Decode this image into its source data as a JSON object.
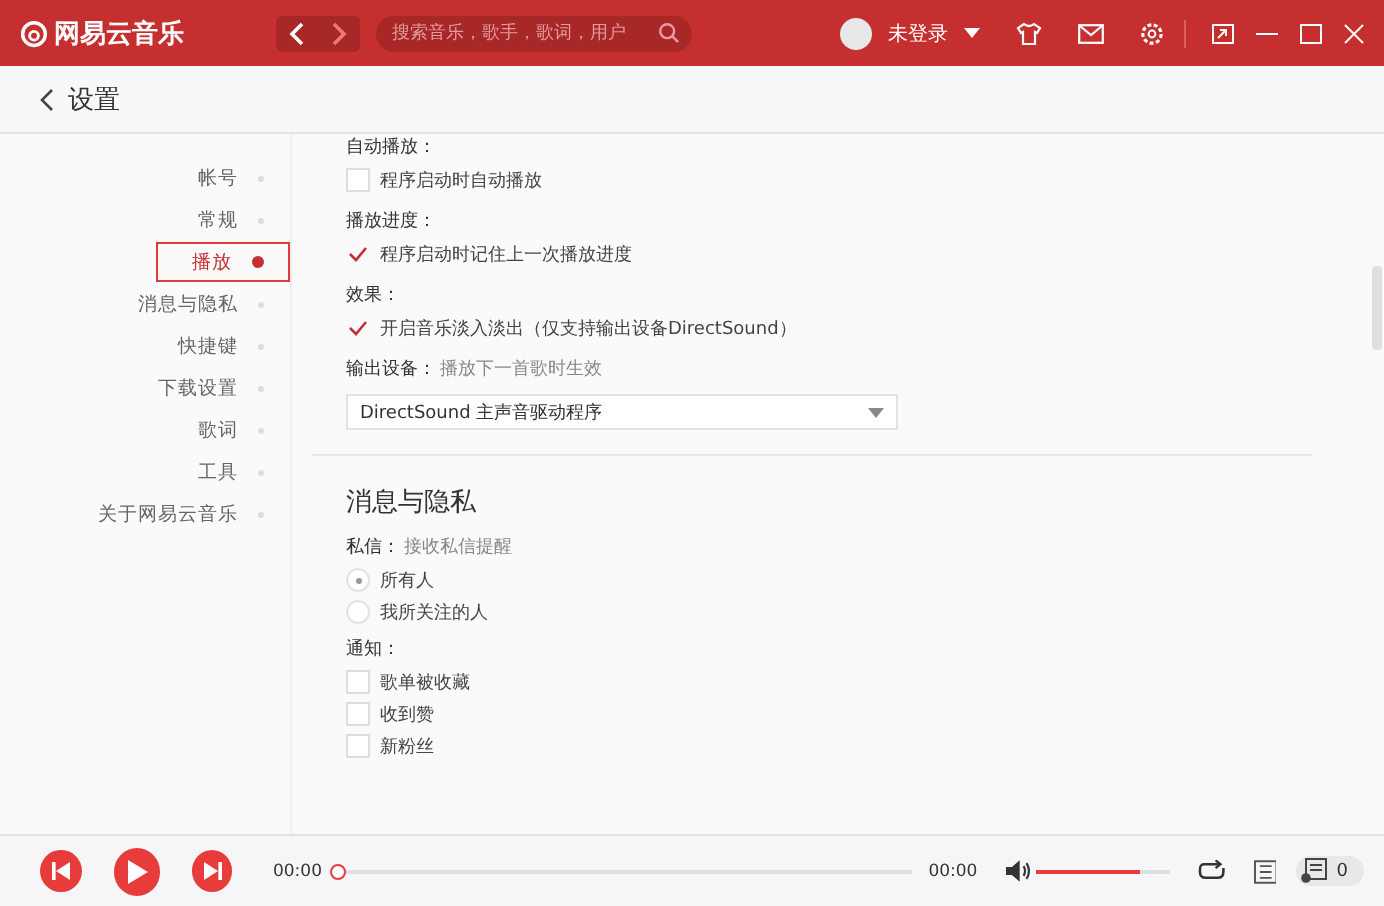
{
  "app": {
    "name": "网易云音乐"
  },
  "search": {
    "placeholder": "搜索音乐，歌手，歌词，用户"
  },
  "user": {
    "label": "未登录"
  },
  "page": {
    "title": "设置"
  },
  "sidebar": {
    "items": [
      {
        "label": "帐号",
        "selected": false
      },
      {
        "label": "常规",
        "selected": false
      },
      {
        "label": "播放",
        "selected": true
      },
      {
        "label": "消息与隐私",
        "selected": false
      },
      {
        "label": "快捷键",
        "selected": false
      },
      {
        "label": "下载设置",
        "selected": false
      },
      {
        "label": "歌词",
        "selected": false
      },
      {
        "label": "工具",
        "selected": false
      },
      {
        "label": "关于网易云音乐",
        "selected": false
      }
    ]
  },
  "sections": [
    {
      "groups": [
        {
          "label": "自动播放：",
          "options": [
            {
              "kind": "checkbox",
              "label": "程序启动时自动播放",
              "checked": false
            }
          ]
        },
        {
          "label": "播放进度：",
          "options": [
            {
              "kind": "checkbox",
              "label": "程序启动时记住上一次播放进度",
              "checked": true
            }
          ]
        },
        {
          "label": "效果：",
          "options": [
            {
              "kind": "checkbox",
              "label": "开启音乐淡入淡出（仅支持输出设备DirectSound）",
              "checked": true
            }
          ]
        },
        {
          "label": "输出设备：",
          "hint": "播放下一首歌时生效",
          "select": {
            "value": "DirectSound 主声音驱动程序"
          }
        }
      ]
    },
    {
      "heading": "消息与隐私",
      "groups": [
        {
          "label": "私信：",
          "hint": "接收私信提醒",
          "options": [
            {
              "kind": "radio",
              "label": "所有人",
              "selected": true
            },
            {
              "kind": "radio",
              "label": "我所关注的人",
              "selected": false
            }
          ]
        },
        {
          "label": "通知：",
          "options": [
            {
              "kind": "checkbox",
              "label": "歌单被收藏",
              "checked": false
            },
            {
              "kind": "checkbox",
              "label": "收到赞",
              "checked": false
            },
            {
              "kind": "checkbox",
              "label": "新粉丝",
              "checked": false
            }
          ]
        }
      ]
    }
  ],
  "player": {
    "elapsed": "00:00",
    "duration": "00:00",
    "progress": {
      "level": 0
    },
    "volume": {
      "level": 0.78
    },
    "playlist_count": "0"
  }
}
